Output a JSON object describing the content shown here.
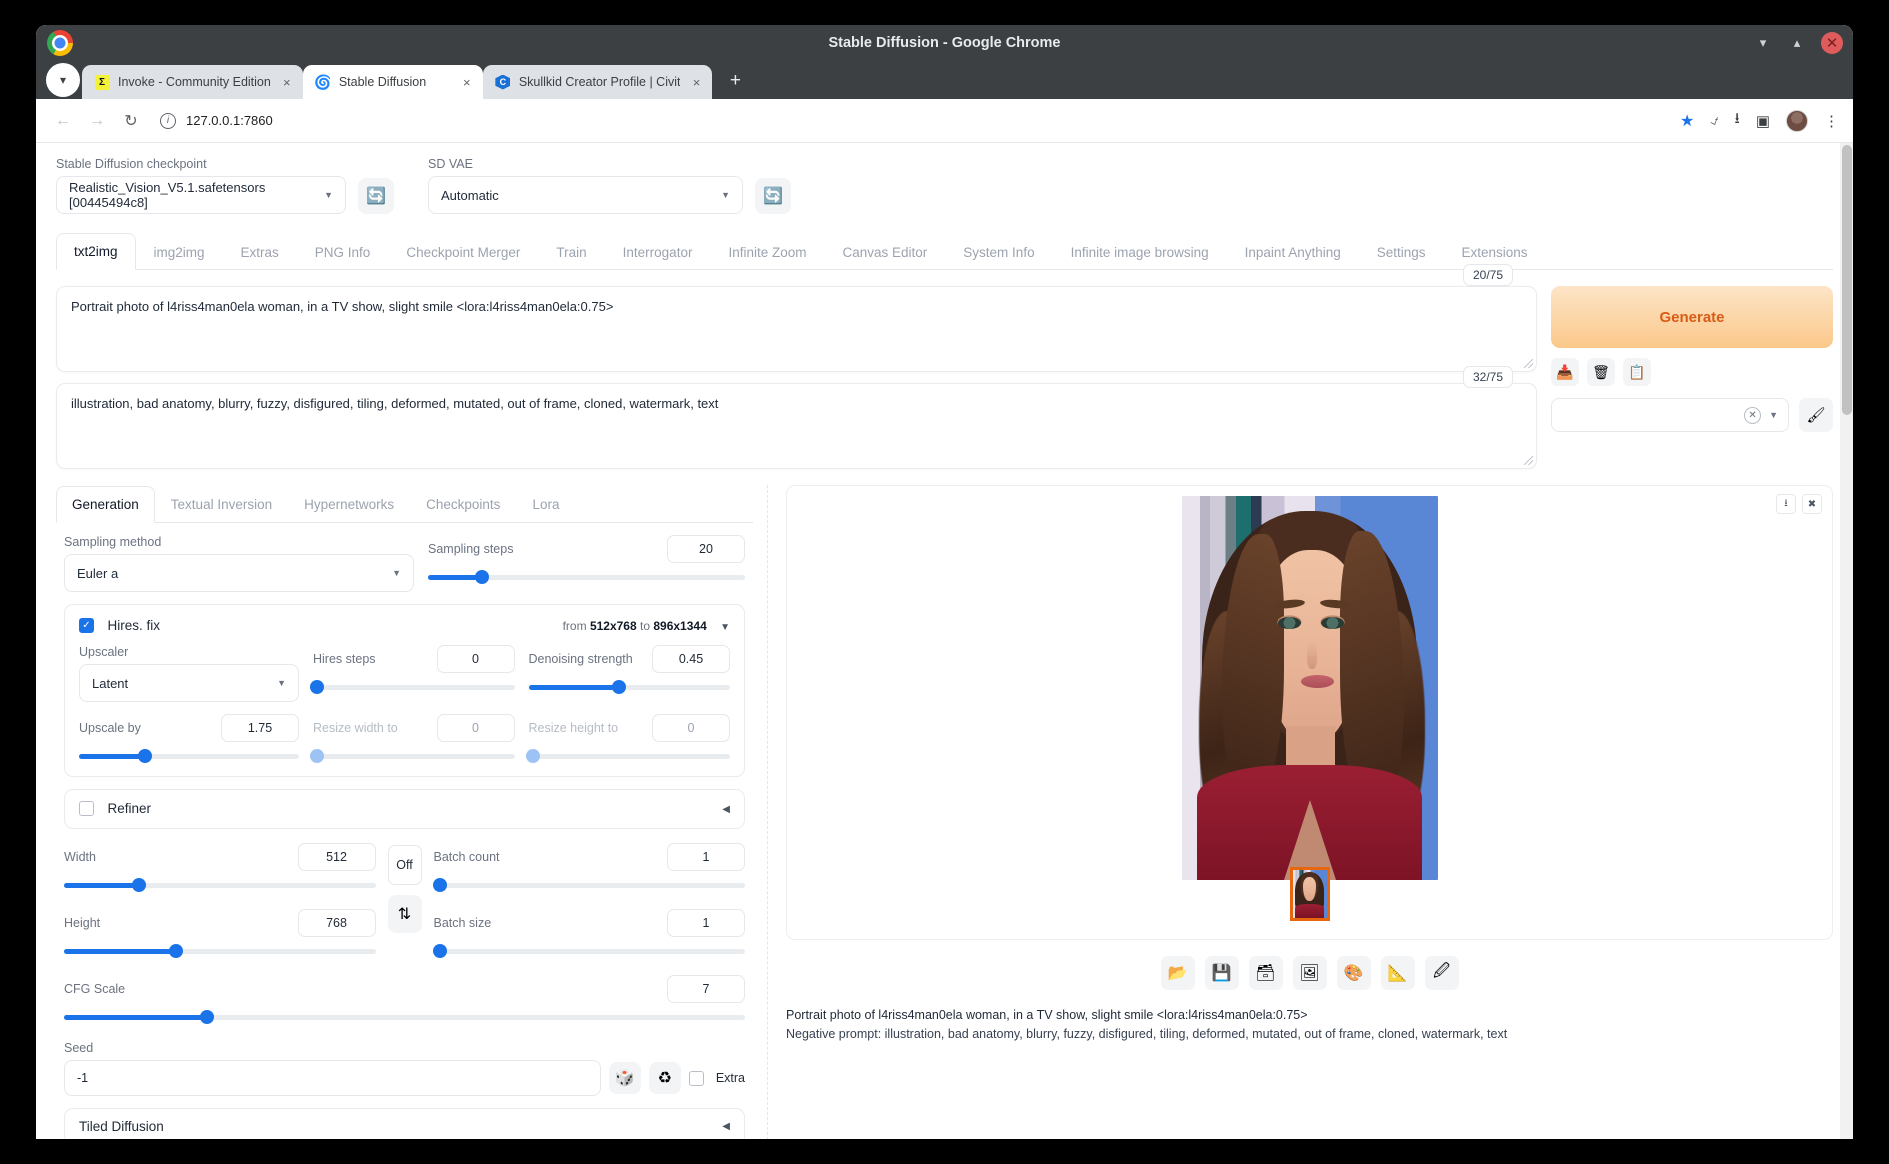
{
  "window": {
    "title": "Stable Diffusion - Google Chrome",
    "minimize_icon": "chevron-down-icon",
    "maximize_icon": "chevron-up-icon",
    "close_icon": "close-icon"
  },
  "tabs": [
    {
      "title": "Invoke - Community Edition",
      "favicon": "invoke-icon",
      "favicon_glyph": "∑",
      "active": false,
      "close_label": "×"
    },
    {
      "title": "Stable Diffusion",
      "favicon": "stable-diffusion-icon",
      "favicon_glyph": "🌀",
      "active": true,
      "close_label": "×"
    },
    {
      "title": "Skullkid Creator Profile | Civit",
      "favicon": "civitai-icon",
      "favicon_glyph": "C",
      "active": false,
      "close_label": "×"
    }
  ],
  "browser": {
    "tab_list_icon": "chevron-down-icon",
    "new_tab_label": "+",
    "back_icon": "arrow-left-icon",
    "forward_icon": "arrow-right-icon",
    "reload_icon": "reload-icon",
    "site_info_icon": "info-circle-icon",
    "url": "127.0.0.1:7860",
    "bookmark_icon": "star-icon",
    "extensions_icon": "puzzle-icon",
    "downloads_icon": "download-icon",
    "side_panel_icon": "side-panel-icon",
    "profile_icon": "avatar",
    "menu_icon": "three-dots-icon"
  },
  "top": {
    "checkpoint_label": "Stable Diffusion checkpoint",
    "checkpoint_value": "Realistic_Vision_V5.1.safetensors [00445494c8]",
    "checkpoint_refresh_icon": "refresh-icon",
    "vae_label": "SD VAE",
    "vae_value": "Automatic",
    "vae_refresh_icon": "refresh-icon"
  },
  "main_tabs": [
    {
      "label": "txt2img",
      "active": true
    },
    {
      "label": "img2img",
      "active": false
    },
    {
      "label": "Extras",
      "active": false
    },
    {
      "label": "PNG Info",
      "active": false
    },
    {
      "label": "Checkpoint Merger",
      "active": false
    },
    {
      "label": "Train",
      "active": false
    },
    {
      "label": "Interrogator",
      "active": false
    },
    {
      "label": "Infinite Zoom",
      "active": false
    },
    {
      "label": "Canvas Editor",
      "active": false
    },
    {
      "label": "System Info",
      "active": false
    },
    {
      "label": "Infinite image browsing",
      "active": false
    },
    {
      "label": "Inpaint Anything",
      "active": false
    },
    {
      "label": "Settings",
      "active": false
    },
    {
      "label": "Extensions",
      "active": false
    }
  ],
  "prompts": {
    "positive": "Portrait photo of l4riss4man0ela woman, in a TV show, slight smile  <lora:l4riss4man0ela:0.75>",
    "positive_tokens": "20/75",
    "negative": "illustration, bad anatomy, blurry, fuzzy, disfigured, tiling, deformed, mutated, out of frame, cloned, watermark, text",
    "negative_tokens": "32/75"
  },
  "generate": {
    "label": "Generate",
    "buttons": [
      {
        "name": "read-generation-parameters-button",
        "icon": "arrow-into-corner-icon",
        "glyph": "↙"
      },
      {
        "name": "clear-prompt-button",
        "icon": "trash-icon",
        "glyph": "🗑"
      },
      {
        "name": "paste-styles-button",
        "icon": "clipboard-icon",
        "glyph": "📋"
      }
    ],
    "styles_value": "",
    "styles_clear_icon": "clear-x-icon",
    "styles_caret_icon": "chevron-down-icon",
    "apply_styles_icon": "paintbrush-icon",
    "apply_styles_glyph": "🖌"
  },
  "sub_tabs": [
    {
      "label": "Generation",
      "active": true
    },
    {
      "label": "Textual Inversion",
      "active": false
    },
    {
      "label": "Hypernetworks",
      "active": false
    },
    {
      "label": "Checkpoints",
      "active": false
    },
    {
      "label": "Lora",
      "active": false
    }
  ],
  "settings": {
    "sampling_method_label": "Sampling method",
    "sampling_method_value": "Euler a",
    "sampling_steps_label": "Sampling steps",
    "sampling_steps_value": "20",
    "sampling_steps_pct": 17,
    "hires_fix_label": "Hires. fix",
    "hires_fix_checked": true,
    "hires_from_prefix": "from",
    "hires_from": "512x768",
    "hires_to_prefix": "to",
    "hires_to": "896x1344",
    "hires_collapse_icon": "triangle-down-icon",
    "upscaler_label": "Upscaler",
    "upscaler_value": "Latent",
    "hires_steps_label": "Hires steps",
    "hires_steps_value": "0",
    "hires_steps_pct": 2,
    "denoising_label": "Denoising strength",
    "denoising_value": "0.45",
    "denoising_pct": 45,
    "upscale_by_label": "Upscale by",
    "upscale_by_value": "1.75",
    "upscale_by_pct": 30,
    "resize_width_label": "Resize width to",
    "resize_width_value": "0",
    "resize_width_pct": 2,
    "resize_height_label": "Resize height to",
    "resize_height_value": "0",
    "resize_height_pct": 2,
    "refiner_label": "Refiner",
    "refiner_checked": false,
    "refiner_collapse_icon": "triangle-left-icon",
    "width_label": "Width",
    "width_value": "512",
    "width_pct": 24,
    "height_label": "Height",
    "height_value": "768",
    "height_pct": 36,
    "cfg_label": "CFG Scale",
    "cfg_value": "7",
    "cfg_pct": 21,
    "swap_off_label": "Off",
    "swap_icon": "swap-arrows-icon",
    "swap_glyph": "⇅",
    "batch_count_label": "Batch count",
    "batch_count_value": "1",
    "batch_count_pct": 2,
    "batch_size_label": "Batch size",
    "batch_size_value": "1",
    "batch_size_pct": 2,
    "seed_label": "Seed",
    "seed_value": "-1",
    "seed_random_icon": "dice-icon",
    "seed_random_glyph": "🎲",
    "seed_recycle_icon": "recycle-icon",
    "seed_recycle_glyph": "♻",
    "seed_extra_label": "Extra",
    "seed_extra_checked": false,
    "tiled_diffusion_label": "Tiled Diffusion",
    "tiled_diffusion_collapse_icon": "triangle-left-icon"
  },
  "result": {
    "download_icon": "download-icon",
    "close_icon": "close-x-icon",
    "gallery_thumb_name": "generated-image-thumbnail",
    "toolbar": [
      {
        "name": "open-folder-button",
        "icon": "folder-icon",
        "glyph": "📂"
      },
      {
        "name": "save-button",
        "icon": "floppy-disk-icon",
        "glyph": "💾"
      },
      {
        "name": "zip-button",
        "icon": "file-box-icon",
        "glyph": "🗃"
      },
      {
        "name": "send-to-img2img-button",
        "icon": "framed-picture-icon",
        "glyph": "🖼"
      },
      {
        "name": "send-to-inpaint-button",
        "icon": "palette-icon",
        "glyph": "🎨"
      },
      {
        "name": "send-to-extras-button",
        "icon": "ruler-icon",
        "glyph": "📐"
      },
      {
        "name": "send-to-other-button",
        "icon": "pin-icon",
        "glyph": "🖉"
      }
    ],
    "info_line1": "Portrait photo of l4riss4man0ela woman, in a TV show, slight smile <lora:l4riss4man0ela:0.75>",
    "info_line2": "Negative prompt: illustration, bad anatomy, blurry, fuzzy, disfigured, tiling, deformed, mutated, out of frame, cloned, watermark, text"
  },
  "colors": {
    "accent_blue": "#1a73e8",
    "generate_orange": "#d85c16",
    "thumb_border": "#e8670c",
    "titlebar": "#3c4043"
  }
}
